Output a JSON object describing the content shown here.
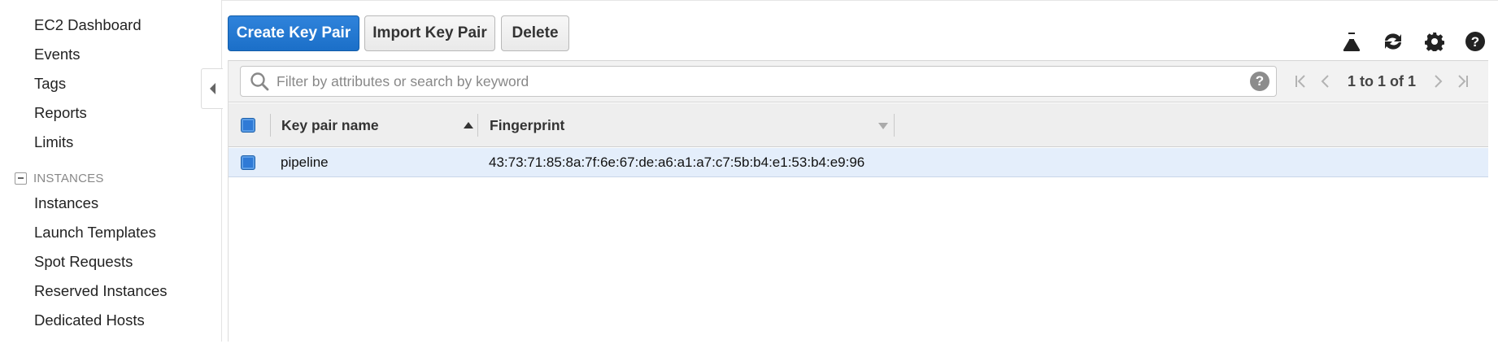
{
  "sidebar": {
    "items_top": [
      "EC2 Dashboard",
      "Events",
      "Tags",
      "Reports",
      "Limits"
    ],
    "section": {
      "label": "INSTANCES",
      "collapsed": false
    },
    "items_instances": [
      "Instances",
      "Launch Templates",
      "Spot Requests",
      "Reserved Instances",
      "Dedicated Hosts"
    ]
  },
  "toolbar": {
    "create_label": "Create Key Pair",
    "import_label": "Import Key Pair",
    "delete_label": "Delete",
    "icons": [
      "flask-icon",
      "refresh-icon",
      "gear-icon",
      "help-icon"
    ]
  },
  "search": {
    "placeholder": "Filter by attributes or search by keyword",
    "value": ""
  },
  "pager": {
    "text": "1 to 1 of 1"
  },
  "table": {
    "columns": [
      "Key pair name",
      "Fingerprint"
    ],
    "sort": {
      "column": "Key pair name",
      "direction": "ascending"
    },
    "rows": [
      {
        "name": "pipeline",
        "fingerprint": "43:73:71:85:8a:7f:6e:67:de:a6:a1:a7:c7:5b:b4:e1:53:b4:e9:96",
        "selected": true
      }
    ]
  },
  "colors": {
    "primary": "#1b6fc8",
    "selected_row": "#e4eefb",
    "header_bg": "#eeeeee"
  }
}
